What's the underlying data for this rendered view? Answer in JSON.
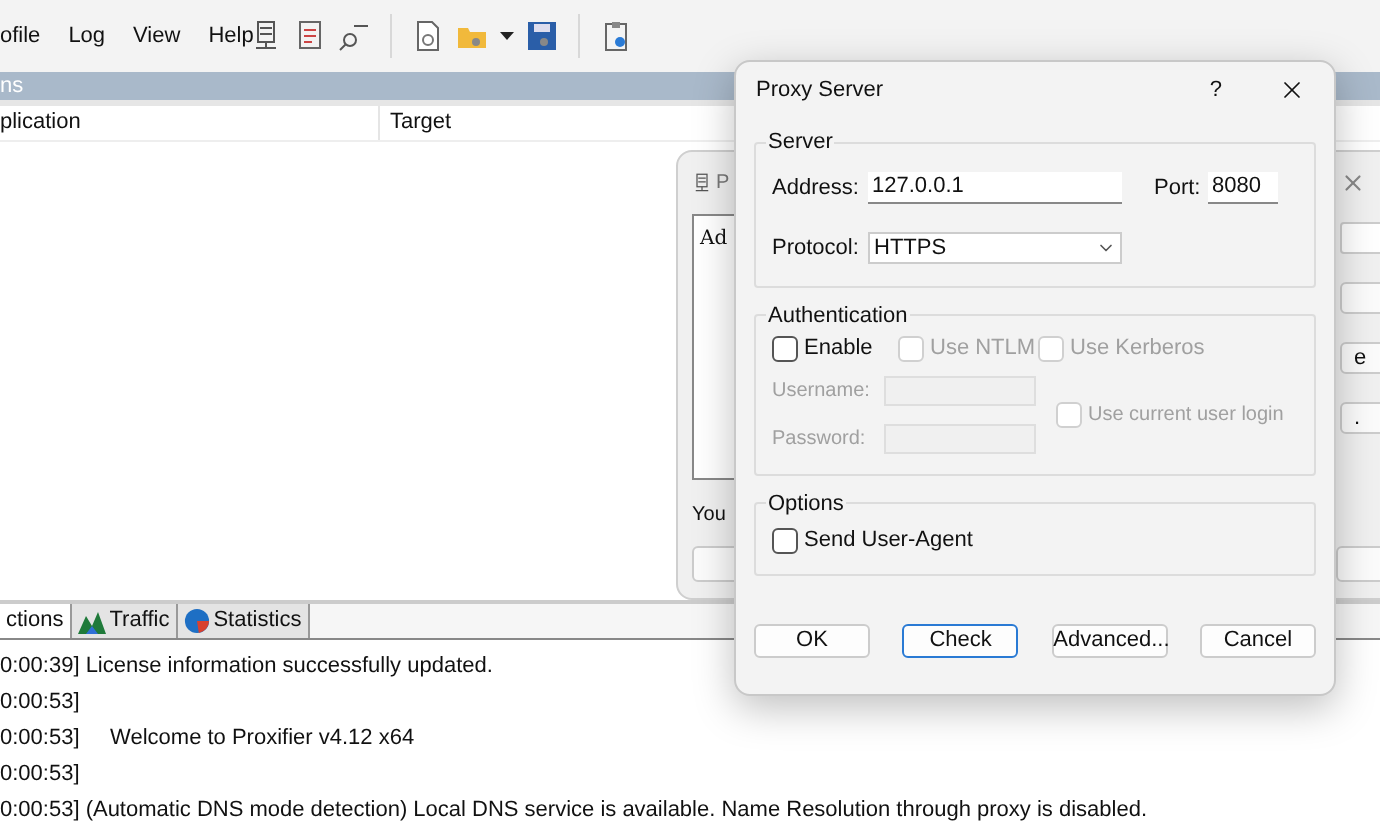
{
  "main_window": {
    "menu": [
      "ofile",
      "Log",
      "View",
      "Help"
    ],
    "pane_title": "ns",
    "columns": [
      "plication",
      "Target"
    ],
    "tabs": [
      {
        "label": "ctions",
        "selected": true,
        "kind": "plain"
      },
      {
        "label": "Traffic",
        "selected": false,
        "kind": "traffic"
      },
      {
        "label": "Statistics",
        "selected": false,
        "kind": "statistics"
      }
    ],
    "log": [
      "0:00:39] License information successfully updated.",
      "0:00:53]",
      "0:00:53]     Welcome to Proxifier v4.12 x64",
      "0:00:53]",
      "0:00:53] (Automatic DNS mode detection) Local DNS service is available. Name Resolution through proxy is disabled."
    ]
  },
  "back_dialog": {
    "title": "P",
    "list_text": "Ad",
    "footer_text": "You",
    "side_buttons": [
      "e",
      "."
    ]
  },
  "proxy_dialog": {
    "title": "Proxy Server",
    "help": "?",
    "server": {
      "title": "Server",
      "address_label": "Address:",
      "address": "127.0.0.1",
      "port_label": "Port:",
      "port": "8080",
      "protocol_label": "Protocol:",
      "protocol": "HTTPS"
    },
    "auth": {
      "title": "Authentication",
      "checks": [
        {
          "label": "Enable",
          "checked": false,
          "disabled": false
        },
        {
          "label": "Use NTLM",
          "checked": false,
          "disabled": true
        },
        {
          "label": "Use Kerberos",
          "checked": false,
          "disabled": true
        }
      ],
      "username_label": "Username:",
      "password_label": "Password:",
      "fields_disabled": true,
      "current_login": {
        "label": "Use current user login",
        "checked": false,
        "disabled": true
      }
    },
    "options": {
      "title": "Options",
      "checks": [
        {
          "label": "Send User-Agent",
          "checked": false,
          "disabled": false
        }
      ]
    },
    "buttons": [
      {
        "label": "OK",
        "focused": false
      },
      {
        "label": "Check",
        "focused": true
      },
      {
        "label": "Advanced...",
        "focused": false
      },
      {
        "label": "Cancel",
        "focused": false
      }
    ]
  }
}
